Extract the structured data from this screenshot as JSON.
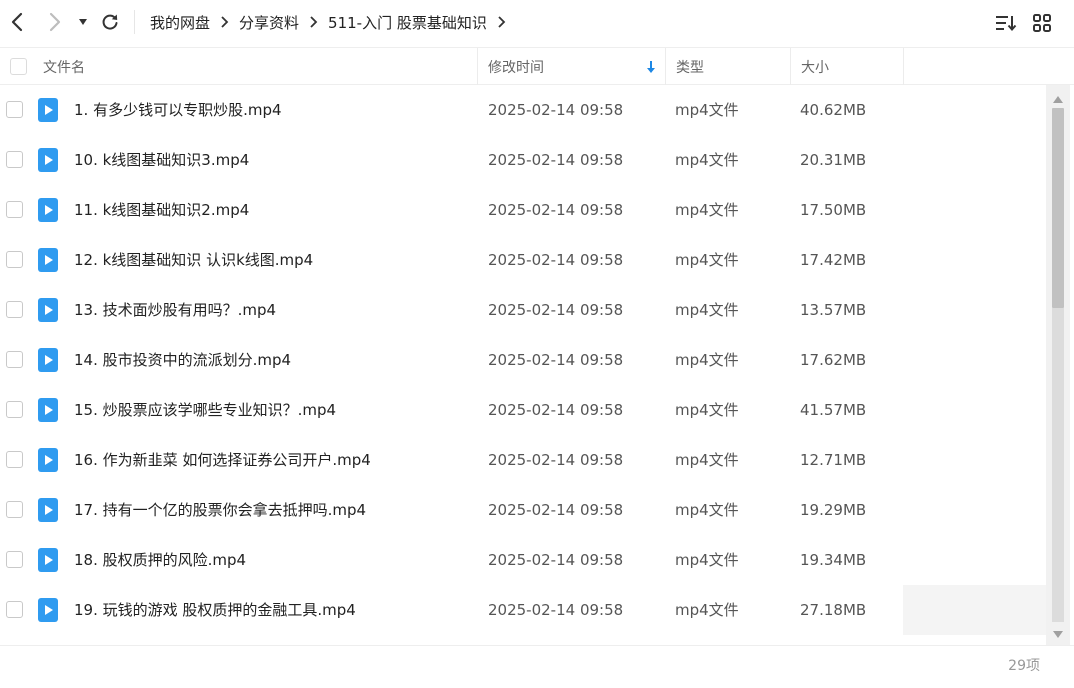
{
  "toolbar": {
    "back_icon": "back-arrow-icon",
    "forward_icon": "forward-arrow-icon",
    "history_icon": "dropdown-caret-icon",
    "refresh_icon": "refresh-icon",
    "sort_icon": "sort-list-icon",
    "view_icon": "grid-view-icon"
  },
  "breadcrumb": [
    "我的网盘",
    "分享资料",
    "511-入门 股票基础知识"
  ],
  "columns": {
    "name": "文件名",
    "modified": "修改时间",
    "type": "类型",
    "size": "大小"
  },
  "files": [
    {
      "name": "1. 有多少钱可以专职炒股.mp4",
      "modified": "2025-02-14 09:58",
      "type": "mp4文件",
      "size": "40.62MB"
    },
    {
      "name": "10. k线图基础知识3.mp4",
      "modified": "2025-02-14 09:58",
      "type": "mp4文件",
      "size": "20.31MB"
    },
    {
      "name": "11. k线图基础知识2.mp4",
      "modified": "2025-02-14 09:58",
      "type": "mp4文件",
      "size": "17.50MB"
    },
    {
      "name": "12. k线图基础知识 认识k线图.mp4",
      "modified": "2025-02-14 09:58",
      "type": "mp4文件",
      "size": "17.42MB"
    },
    {
      "name": "13. 技术面炒股有用吗？.mp4",
      "modified": "2025-02-14 09:58",
      "type": "mp4文件",
      "size": "13.57MB"
    },
    {
      "name": "14. 股市投资中的流派划分.mp4",
      "modified": "2025-02-14 09:58",
      "type": "mp4文件",
      "size": "17.62MB"
    },
    {
      "name": "15. 炒股票应该学哪些专业知识？.mp4",
      "modified": "2025-02-14 09:58",
      "type": "mp4文件",
      "size": "41.57MB"
    },
    {
      "name": "16. 作为新韭菜 如何选择证券公司开户.mp4",
      "modified": "2025-02-14 09:58",
      "type": "mp4文件",
      "size": "12.71MB"
    },
    {
      "name": "17. 持有一个亿的股票你会拿去抵押吗.mp4",
      "modified": "2025-02-14 09:58",
      "type": "mp4文件",
      "size": "19.29MB"
    },
    {
      "name": "18. 股权质押的风险.mp4",
      "modified": "2025-02-14 09:58",
      "type": "mp4文件",
      "size": "19.34MB"
    },
    {
      "name": "19. 玩钱的游戏 股权质押的金融工具.mp4",
      "modified": "2025-02-14 09:58",
      "type": "mp4文件",
      "size": "27.18MB"
    }
  ],
  "footer": {
    "count": "29项"
  },
  "colors": {
    "file_icon": "#2f9bf0",
    "sort_arrow": "#1e88e5"
  }
}
